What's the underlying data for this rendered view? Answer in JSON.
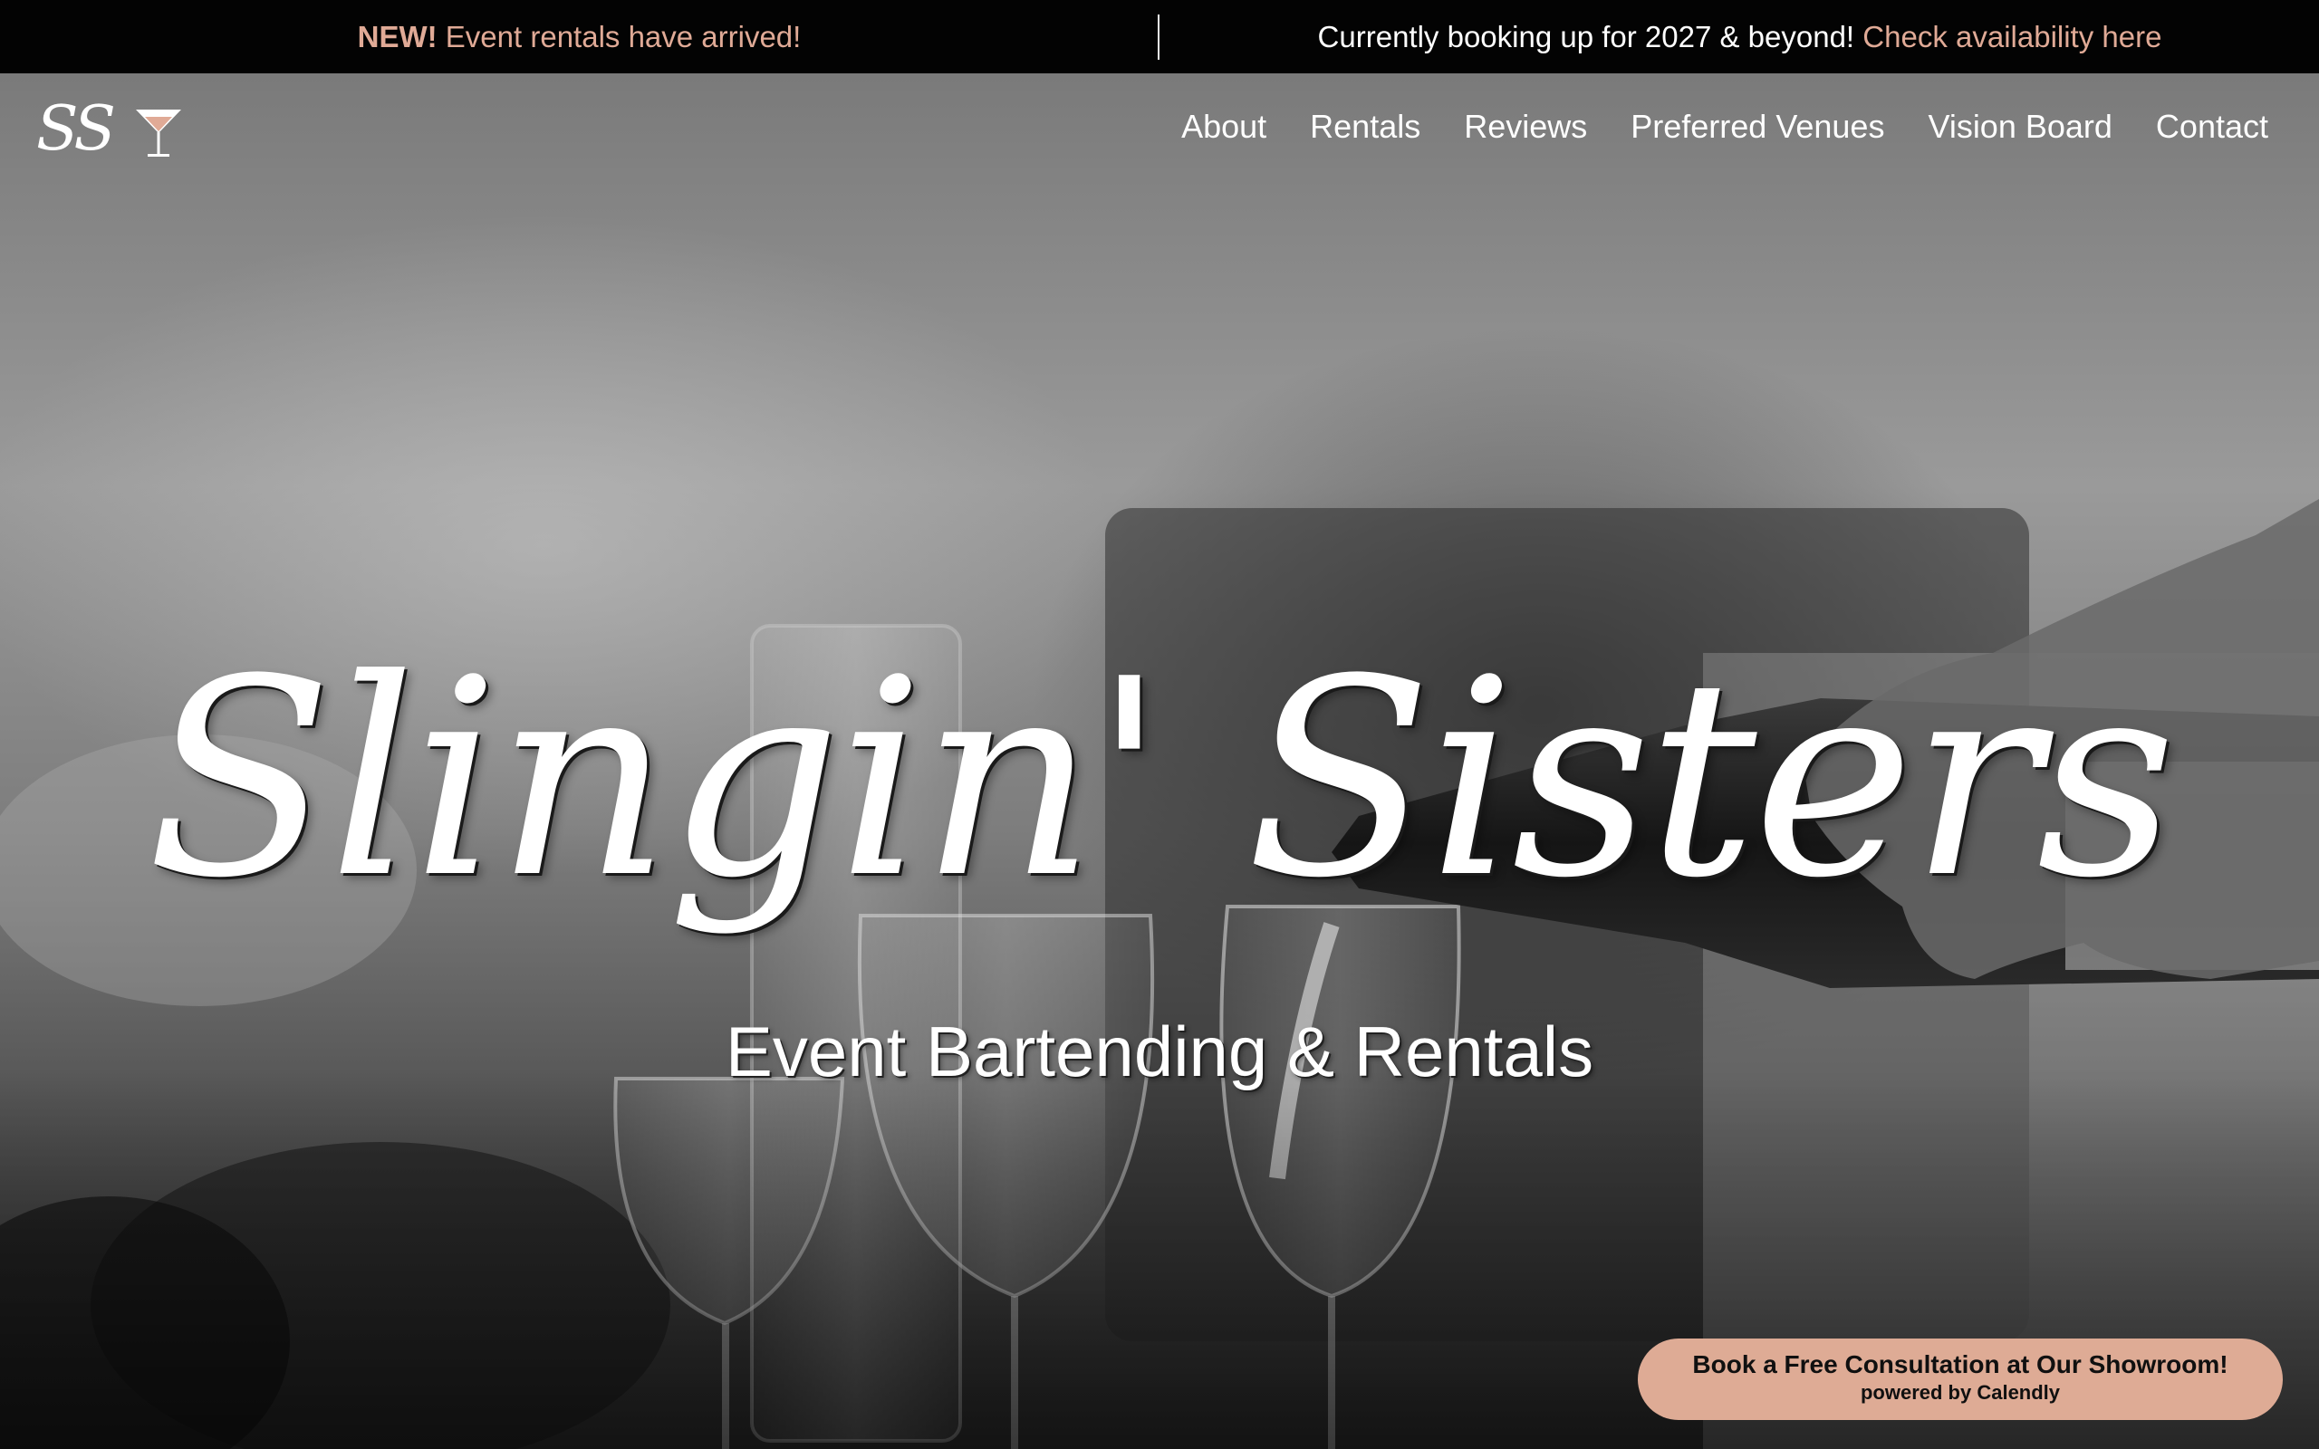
{
  "announcement": {
    "left_highlight": "NEW!",
    "left_text": "Event rentals have arrived!",
    "right_text": "Currently booking up for 2027 & beyond!",
    "right_link": "Check availability here"
  },
  "logo": {
    "monogram": "SS",
    "icon": "martini-glass-icon"
  },
  "nav": {
    "items": [
      "About",
      "Rentals",
      "Reviews",
      "Preferred Venues",
      "Vision Board",
      "Contact"
    ]
  },
  "hero": {
    "title": "Slingin' Sisters",
    "subtitle": "Event Bartending & Rentals"
  },
  "cta": {
    "label": "Book a Free Consultation at Our Showroom!",
    "sublabel": "powered by Calendly"
  },
  "colors": {
    "accent": "#e0aa96",
    "cta_background": "#deab95",
    "bar_background": "#030303"
  }
}
